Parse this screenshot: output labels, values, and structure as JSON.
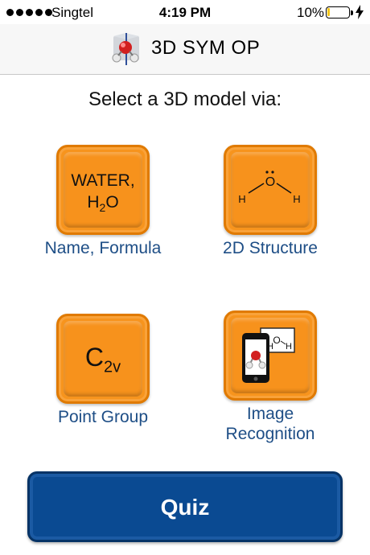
{
  "status_bar": {
    "carrier": "Singtel",
    "time": "4:19 PM",
    "battery": "10%",
    "battery_level": 0.1
  },
  "nav": {
    "title": "3D SYM OP",
    "logo_icon": "molecule-axes-icon"
  },
  "prompt": "Select a 3D model via:",
  "tiles": [
    {
      "label": "Name, Formula",
      "icon_line1": "WATER,",
      "icon_formula_main": "H",
      "icon_formula_sub": "2",
      "icon_formula_end": "O",
      "icon": "name-formula-icon"
    },
    {
      "label": "2D Structure",
      "atom_o": "O",
      "atom_h1": "H",
      "atom_h2": "H",
      "icon": "water-structure-icon"
    },
    {
      "label": "Point Group",
      "pg_main": "C",
      "pg_sub": "2v",
      "icon": "point-group-icon"
    },
    {
      "label_line1": "Image",
      "label_line2": "Recognition",
      "card_o": "O",
      "card_h1": "H",
      "card_h2": "H",
      "icon": "phone-camera-icon"
    }
  ],
  "quiz": {
    "label": "Quiz"
  },
  "colors": {
    "tile_orange": "#f7941d",
    "label_blue": "#1e4e86",
    "quiz_blue": "#0a4a92",
    "battery_yellow": "#f5c518"
  }
}
